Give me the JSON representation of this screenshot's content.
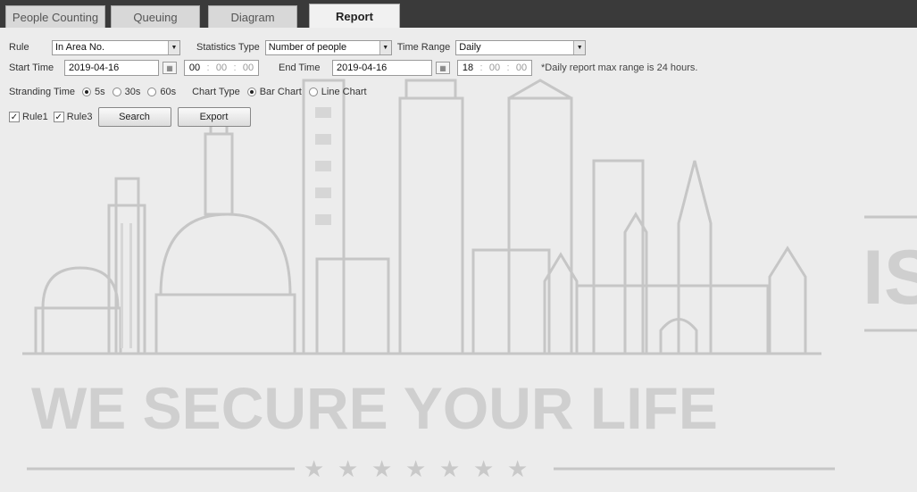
{
  "tabs": [
    {
      "label": "People Counting"
    },
    {
      "label": "Queuing"
    },
    {
      "label": "Diagram"
    },
    {
      "label": "Report"
    }
  ],
  "form": {
    "rule_label": "Rule",
    "rule_value": "In Area No.",
    "stat_type_label": "Statistics Type",
    "stat_type_value": "Number of people",
    "time_range_label": "Time Range",
    "time_range_value": "Daily",
    "start_time_label": "Start Time",
    "start_date": "2019-04-16",
    "start_h": "00",
    "start_m": "00",
    "start_s": "00",
    "end_time_label": "End Time",
    "end_date": "2019-04-16",
    "end_h": "18",
    "end_m": "00",
    "end_s": "00",
    "note": "*Daily report max range is 24 hours.",
    "stranding_label": "Stranding Time",
    "stranding_options": [
      "5s",
      "30s",
      "60s"
    ],
    "stranding_selected": "5s",
    "chart_type_label": "Chart Type",
    "chart_options": [
      "Bar Chart",
      "Line Chart"
    ],
    "chart_selected": "Bar Chart",
    "rules": [
      {
        "label": "Rule1",
        "checked": true
      },
      {
        "label": "Rule3",
        "checked": true
      }
    ],
    "search_label": "Search",
    "export_label": "Export"
  },
  "watermark": {
    "slogan": "WE SECURE YOUR LIFE",
    "side_text": "IS"
  },
  "colors": {
    "tabbar": "#3a3a3a",
    "background": "#ececec",
    "watermark": "#c8c8c8"
  }
}
